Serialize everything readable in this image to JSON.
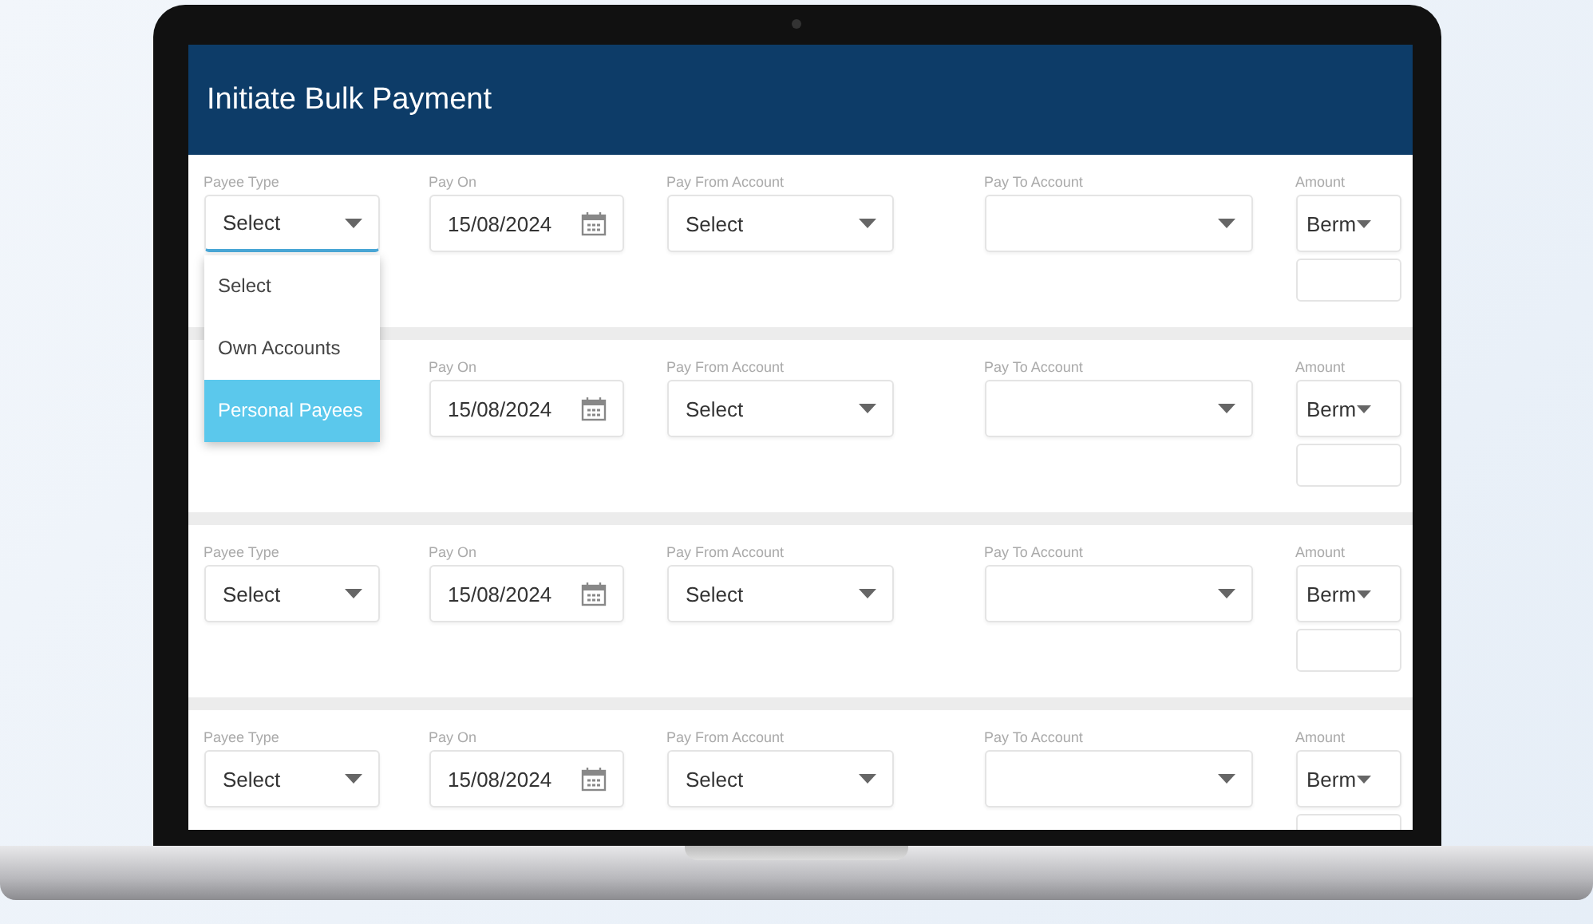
{
  "header": {
    "title": "Initiate Bulk Payment"
  },
  "rows": [
    {
      "payee_type": {
        "label": "Payee Type",
        "value": "Select",
        "open": true
      },
      "pay_on": {
        "label": "Pay On",
        "value": "15/08/2024"
      },
      "pay_from": {
        "label": "Pay From Account",
        "value": "Select"
      },
      "pay_to": {
        "label": "Pay To Account"
      },
      "amount": {
        "label": "Amount",
        "currency": "Berm"
      }
    },
    {
      "pay_on": {
        "label": "Pay On",
        "value": "15/08/2024"
      },
      "pay_from": {
        "label": "Pay From Account",
        "value": "Select"
      },
      "pay_to": {
        "label": "Pay To Account"
      },
      "amount": {
        "label": "Amount",
        "currency": "Berm"
      }
    },
    {
      "payee_type": {
        "label": "Payee Type",
        "value": "Select",
        "open": false
      },
      "pay_on": {
        "label": "Pay On",
        "value": "15/08/2024"
      },
      "pay_from": {
        "label": "Pay From Account",
        "value": "Select"
      },
      "pay_to": {
        "label": "Pay To Account"
      },
      "amount": {
        "label": "Amount",
        "currency": "Berm"
      }
    },
    {
      "payee_type": {
        "label": "Payee Type",
        "value": "Select",
        "open": false
      },
      "pay_on": {
        "label": "Pay On",
        "value": "15/08/2024"
      },
      "pay_from": {
        "label": "Pay From Account",
        "value": "Select"
      },
      "pay_to": {
        "label": "Pay To Account"
      },
      "amount": {
        "label": "Amount",
        "currency": "Berm"
      }
    }
  ],
  "payee_type_menu": {
    "options": [
      {
        "label": "Select",
        "selected": false
      },
      {
        "label": "Own Accounts",
        "selected": false
      },
      {
        "label": "Personal Payees",
        "selected": true
      }
    ]
  }
}
